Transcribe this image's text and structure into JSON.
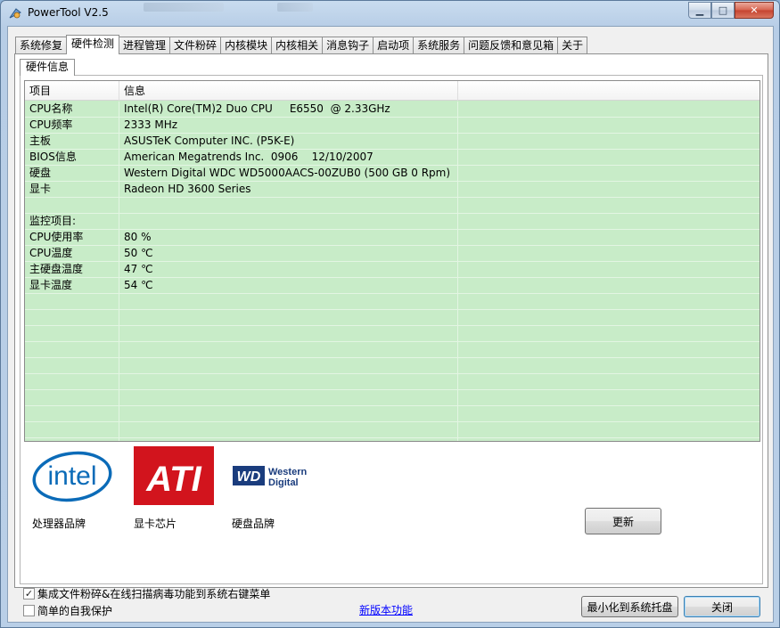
{
  "window": {
    "title": "PowerTool V2.5",
    "minimize_glyph": "▁",
    "maximize_glyph": "□",
    "close_glyph": "✕"
  },
  "tabs": [
    {
      "label": "系统修复"
    },
    {
      "label": "硬件检测",
      "active": true
    },
    {
      "label": "进程管理"
    },
    {
      "label": "文件粉碎"
    },
    {
      "label": "内核模块"
    },
    {
      "label": "内核相关"
    },
    {
      "label": "消息钩子"
    },
    {
      "label": "启动项"
    },
    {
      "label": "系统服务"
    },
    {
      "label": "问题反馈和意见箱"
    },
    {
      "label": "关于"
    }
  ],
  "subtab": {
    "label": "硬件信息"
  },
  "grid": {
    "columns": [
      "项目",
      "信息",
      ""
    ],
    "rows": [
      [
        "CPU名称",
        "Intel(R) Core(TM)2 Duo CPU     E6550  @ 2.33GHz"
      ],
      [
        "CPU频率",
        "2333 MHz"
      ],
      [
        "主板",
        "ASUSTeK Computer INC. (P5K-E)"
      ],
      [
        "BIOS信息",
        "American Megatrends Inc.  0906    12/10/2007"
      ],
      [
        "硬盘",
        "Western Digital WDC WD5000AACS-00ZUB0 (500 GB 0 Rpm)"
      ],
      [
        "显卡",
        "Radeon HD 3600 Series"
      ],
      [
        "",
        ""
      ],
      [
        "监控项目:",
        ""
      ],
      [
        "CPU使用率",
        "80 %"
      ],
      [
        "CPU温度",
        "50 ℃"
      ],
      [
        "主硬盘温度",
        "47 ℃"
      ],
      [
        "显卡温度",
        "54 ℃"
      ],
      [
        "",
        ""
      ],
      [
        "",
        ""
      ],
      [
        "",
        ""
      ],
      [
        "",
        ""
      ],
      [
        "",
        ""
      ],
      [
        "",
        ""
      ],
      [
        "",
        ""
      ],
      [
        "",
        ""
      ],
      [
        "",
        ""
      ]
    ],
    "row_color": "#c8ecc8"
  },
  "brands": [
    {
      "label": "处理器品牌",
      "logo_text": "intel",
      "icon": "intel-logo-icon"
    },
    {
      "label": "显卡芯片",
      "logo_text": "ATI",
      "icon": "ati-logo-icon"
    },
    {
      "label": "硬盘品牌",
      "logo_text_wd": "WD",
      "logo_text_1": "Western",
      "logo_text_2": "Digital",
      "icon": "wd-logo-icon"
    }
  ],
  "buttons": {
    "refresh": "更新",
    "minimize_to_tray": "最小化到系统托盘",
    "close": "关闭"
  },
  "options": {
    "integrate_menu": {
      "label": "集成文件粉碎&在线扫描病毒功能到系统右键菜单",
      "checked": true
    },
    "self_protect": {
      "label": "简单的自我保护",
      "checked": false
    }
  },
  "link": {
    "label": "新版本功能"
  },
  "colors": {
    "intel_blue": "#0b6bb8",
    "ati_red": "#d2141d",
    "wd_blue": "#1a3c7d"
  }
}
